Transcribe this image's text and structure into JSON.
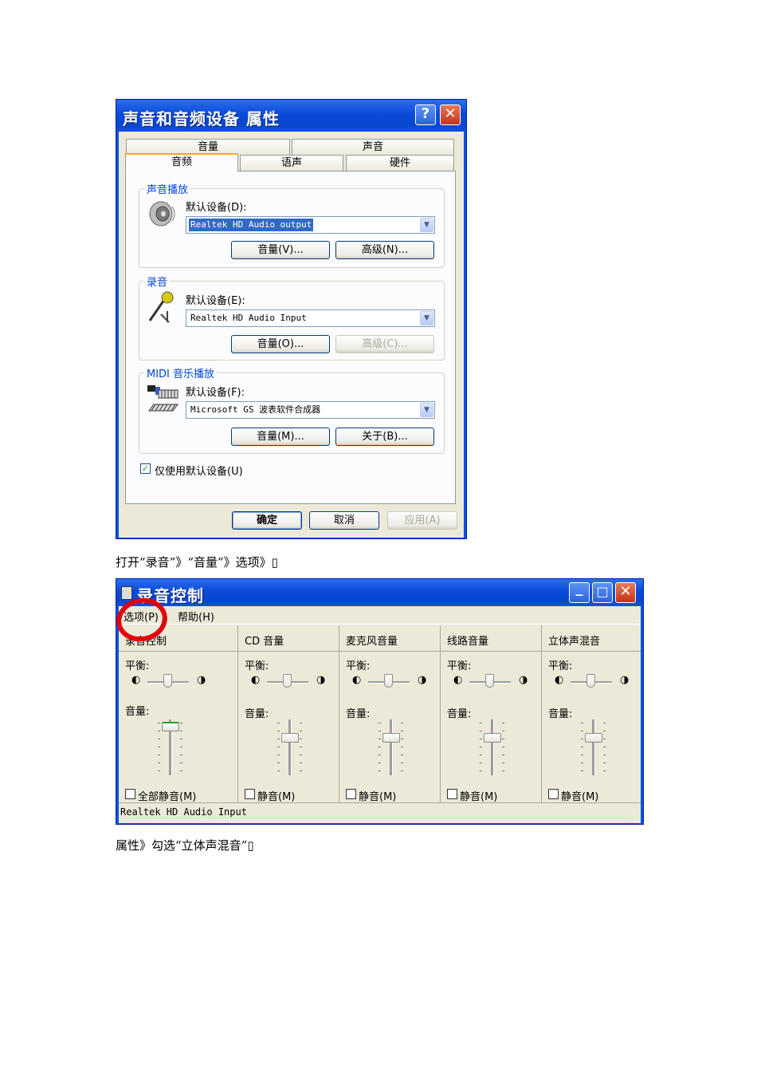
{
  "dialog1": {
    "title": "声音和音频设备 属性",
    "help_glyph": "?",
    "close_glyph": "✕",
    "tabs_row1": [
      "音量",
      "声音"
    ],
    "tabs_row2": [
      "音频",
      "语声",
      "硬件"
    ],
    "playback": {
      "title": "声音播放",
      "device_label": "默认设备(D):",
      "device_value": "Realtek HD Audio output",
      "volume_button": "音量(V)...",
      "advanced_button": "高级(N)..."
    },
    "recording": {
      "title": "录音",
      "device_label": "默认设备(E):",
      "device_value": "Realtek HD Audio Input",
      "volume_button": "音量(O)...",
      "advanced_button": "高级(C)..."
    },
    "midi": {
      "title": "MIDI 音乐播放",
      "device_label": "默认设备(F):",
      "device_value": "Microsoft GS 波表软件合成器",
      "volume_button": "音量(M)...",
      "about_button": "关于(B)..."
    },
    "only_default_label": "仅使用默认设备(U)",
    "only_default_checked": true,
    "ok_button": "确定",
    "cancel_button": "取消",
    "apply_button": "应用(A)"
  },
  "caption1": "打开“录音”》“音量”》选项》▯",
  "dialog2": {
    "title": "录音控制",
    "menu": [
      "选项(P)",
      "帮助(H)"
    ],
    "columns": [
      {
        "name": "录音控制",
        "balance_label": "平衡:",
        "volume_label": "音量:",
        "mute_label": "全部静音(M)",
        "volume_level": 0.95
      },
      {
        "name": "CD 音量",
        "balance_label": "平衡:",
        "volume_label": "音量:",
        "mute_label": "静音(M)",
        "volume_level": 0.7
      },
      {
        "name": "麦克风音量",
        "balance_label": "平衡:",
        "volume_label": "音量:",
        "mute_label": "静音(M)",
        "volume_level": 0.7
      },
      {
        "name": "线路音量",
        "balance_label": "平衡:",
        "volume_label": "音量:",
        "mute_label": "静音(M)",
        "volume_level": 0.7
      },
      {
        "name": "立体声混音",
        "balance_label": "平衡:",
        "volume_label": "音量:",
        "mute_label": "静音(M)",
        "volume_level": 0.7
      }
    ],
    "status": "Realtek HD Audio Input",
    "minimize_glyph": "_",
    "maximize_glyph": "□",
    "close_glyph": "✕"
  },
  "caption2": "属性》勾选“立体声混音”▯",
  "colors": {
    "xp_blue": "#0054e3",
    "group_title": "#0046d5",
    "annotation_red": "#e3000a"
  }
}
